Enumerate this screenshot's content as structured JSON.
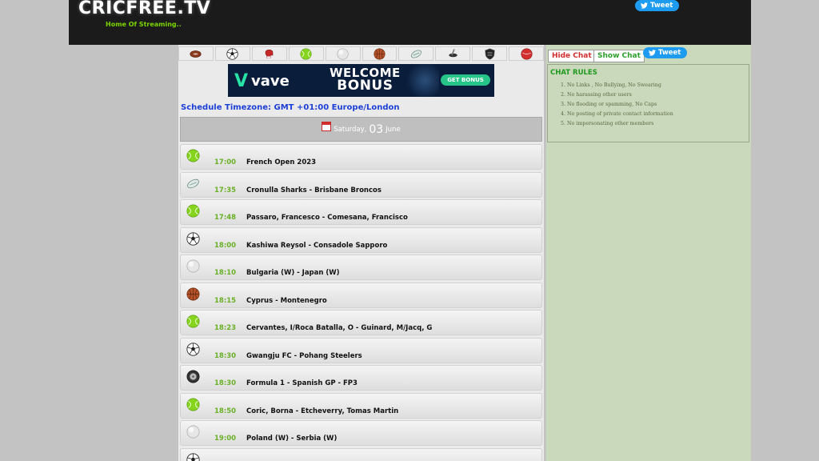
{
  "header": {
    "logo": "CRICFREE.TV",
    "tagline": "Home Of Streaming..",
    "tweet_label": "Tweet"
  },
  "sports_tabs": [
    {
      "name": "american-football-icon",
      "color": "#8a3a1c"
    },
    {
      "name": "soccer-icon",
      "color": "#222222"
    },
    {
      "name": "boxing-icon",
      "color": "#c62828"
    },
    {
      "name": "tennis-icon",
      "color": "#7fd31e"
    },
    {
      "name": "volleyball-icon",
      "color": "#cccccc"
    },
    {
      "name": "basketball-icon",
      "color": "#b5532a"
    },
    {
      "name": "rugby-icon",
      "color": "#7fa8a0"
    },
    {
      "name": "hockey-icon",
      "color": "#333333"
    },
    {
      "name": "nhl-icon",
      "color": "#222222"
    },
    {
      "name": "cricket-icon",
      "color": "#d32f2f"
    }
  ],
  "banner": {
    "brand": "vave",
    "title_line1": "WELCOME",
    "title_line2": "BONUS",
    "cta": "GET BONUS"
  },
  "schedule": {
    "timezone": "Schedule Timezone: GMT +01:00 Europe/London",
    "weekday": "Saturday,",
    "day": "03",
    "month": "June"
  },
  "events": [
    {
      "icon": "tennis-icon",
      "time": "17:00",
      "title": "French Open 2023"
    },
    {
      "icon": "rugby-icon",
      "time": "17:35",
      "title": "Cronulla Sharks - Brisbane Broncos"
    },
    {
      "icon": "tennis-icon",
      "time": "17:48",
      "title": "Passaro, Francesco - Comesana, Francisco"
    },
    {
      "icon": "soccer-icon",
      "time": "18:00",
      "title": "Kashiwa Reysol - Consadole Sapporo"
    },
    {
      "icon": "volleyball-icon",
      "time": "18:10",
      "title": "Bulgaria (W) - Japan (W)"
    },
    {
      "icon": "basketball-icon",
      "time": "18:15",
      "title": "Cyprus - Montenegro"
    },
    {
      "icon": "tennis-icon",
      "time": "18:23",
      "title": "Cervantes, I/Roca Batalla, O - Guinard, M/Jacq, G"
    },
    {
      "icon": "soccer-icon",
      "time": "18:30",
      "title": "Gwangju FC - Pohang Steelers"
    },
    {
      "icon": "wheel-icon",
      "time": "18:30",
      "title": "Formula 1 - Spanish GP - FP3"
    },
    {
      "icon": "tennis-icon",
      "time": "18:50",
      "title": "Coric, Borna - Etcheverry, Tomas Martin"
    },
    {
      "icon": "volleyball-icon",
      "time": "19:00",
      "title": "Poland (W) - Serbia (W)"
    },
    {
      "icon": "soccer-icon",
      "time": "",
      "title": ""
    }
  ],
  "sidebar": {
    "hide_chat": "Hide Chat",
    "show_chat": "Show Chat",
    "tweet_label": "Tweet",
    "rules_title": "CHAT RULES",
    "rules": [
      "No Links , No Bullying, No Swearing",
      "No harassing other users",
      "No flooding or spamming, No Caps",
      "No posting of private contact information",
      "No impersonating other members"
    ]
  }
}
